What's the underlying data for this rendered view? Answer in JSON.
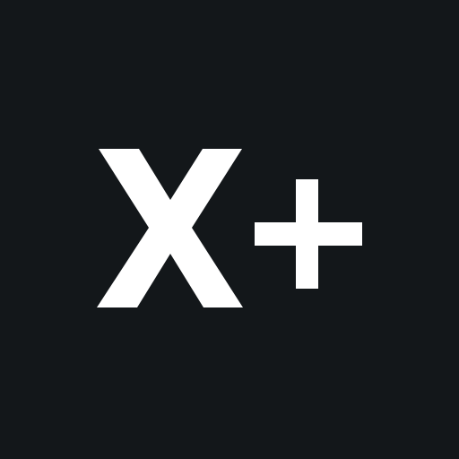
{
  "app": {
    "logo_text": "X+"
  },
  "colors": {
    "background": "#13171a",
    "foreground": "#ffffff"
  },
  "icons": {
    "logo": "x-plus-logo-icon"
  }
}
